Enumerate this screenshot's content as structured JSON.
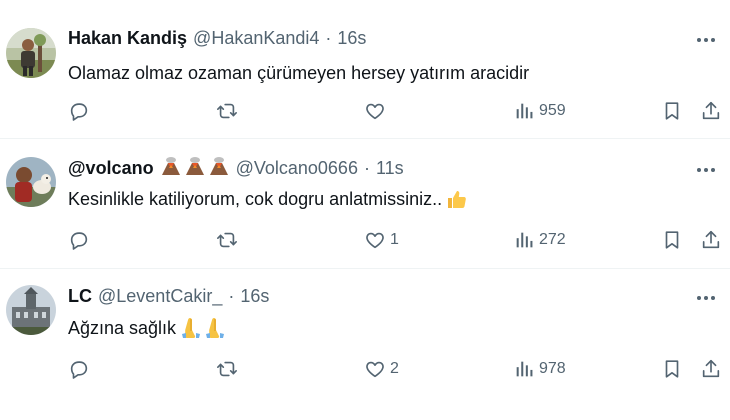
{
  "tweets": [
    {
      "name": "Hakan Kandiş",
      "handle": "@HakanKandi4",
      "separator": "·",
      "time": "16s",
      "text": "Olamaz  olmaz ozaman çürümeyen hersey yatırım aracidir",
      "likes": "",
      "views": "959",
      "avatar": "man-outdoors-avatar"
    },
    {
      "name": "@volcano",
      "name_emojis": [
        "volcano-emoji",
        "volcano-emoji",
        "volcano-emoji"
      ],
      "handle": "@Volcano0666",
      "separator": "·",
      "time": "11s",
      "text": "Kesinlikle katiliyorum, cok dogru anlatmissiniz..",
      "text_emoji": "thumbs-up-emoji",
      "likes": "1",
      "views": "272",
      "avatar": "man-with-dog-avatar"
    },
    {
      "name": "LC",
      "handle": "@LeventCakir_",
      "separator": "·",
      "time": "16s",
      "text": "Ağzına sağlık",
      "text_emoji": "folded-hands-emoji",
      "likes": "2",
      "views": "978",
      "avatar": "building-avatar"
    }
  ],
  "colors": {
    "text": "#0f1419",
    "secondary": "#536471",
    "divider": "#eff3f4"
  }
}
